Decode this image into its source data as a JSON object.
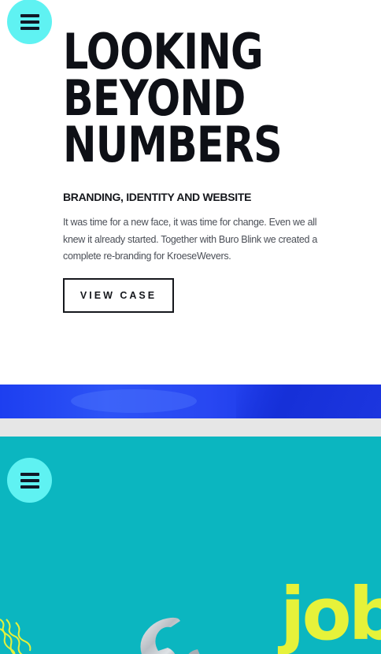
{
  "navigation": {
    "menu_icon": "hamburger-menu-icon",
    "menu_button_color": "#5ff2f2"
  },
  "project": {
    "headline_lines": [
      "LOOKING",
      "BEYOND",
      "NUMBERS"
    ],
    "subheading": "BRANDING, IDENTITY AND WEBSITE",
    "description": "It was time for a new face, it was time for change. Even we all knew it already started. Together with Buro Blink we created a complete re-branding for KroeseWevers.",
    "cta_label": "VIEW CASE"
  },
  "next_project": {
    "background_color": "#0bb6c0",
    "headline_word": "job",
    "headline_color": "#e6f23a",
    "artwork_icons": [
      "wrench-icon",
      "squiggle-lines-icon"
    ]
  },
  "colors": {
    "text_primary": "#0e1016",
    "text_body": "#4b4f57",
    "image_strip_blue": "#2847f2",
    "divider_grey": "#e6e6e6"
  }
}
